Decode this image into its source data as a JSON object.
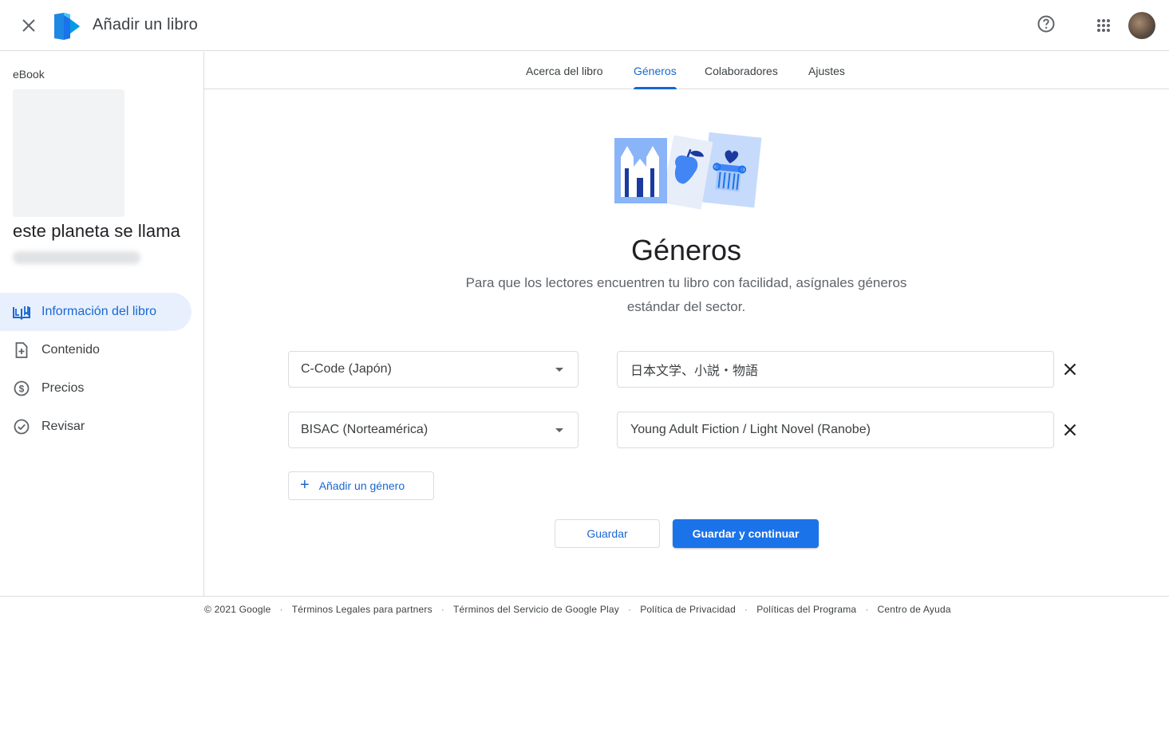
{
  "header": {
    "title": "Añadir un libro"
  },
  "sidebar": {
    "book_type": "eBook",
    "book_title": "este planeta se llama",
    "items": [
      {
        "label": "Información del libro",
        "icon": "book-open-icon"
      },
      {
        "label": "Contenido",
        "icon": "file-add-icon"
      },
      {
        "label": "Precios",
        "icon": "dollar-circle-icon"
      },
      {
        "label": "Revisar",
        "icon": "check-circle-icon"
      }
    ]
  },
  "tabs": [
    {
      "label": "Acerca del libro"
    },
    {
      "label": "Géneros"
    },
    {
      "label": "Colaboradores"
    },
    {
      "label": "Ajustes"
    }
  ],
  "main": {
    "title": "Géneros",
    "subtitle": "Para que los lectores encuentren tu libro con facilidad, asígnales géneros estándar del sector.",
    "genres": [
      {
        "scheme": "C-Code (Japón)",
        "value": "日本文学、小説・物語"
      },
      {
        "scheme": "BISAC (Norteamérica)",
        "value": "Young Adult Fiction / Light Novel (Ranobe)"
      }
    ],
    "add_genre_label": "Añadir un género",
    "save_label": "Guardar",
    "save_continue_label": "Guardar y continuar"
  },
  "footer": {
    "links": [
      "© 2021 Google",
      "Términos Legales para partners",
      "Términos del Servicio de Google Play",
      "Política de Privacidad",
      "Políticas del Programa",
      "Centro de Ayuda"
    ],
    "separator": "·"
  },
  "colors": {
    "accent": "#1a73e8",
    "accent_text": "#1967d2",
    "active_nav_bg": "#e8f0fe",
    "border": "#dadce0"
  }
}
